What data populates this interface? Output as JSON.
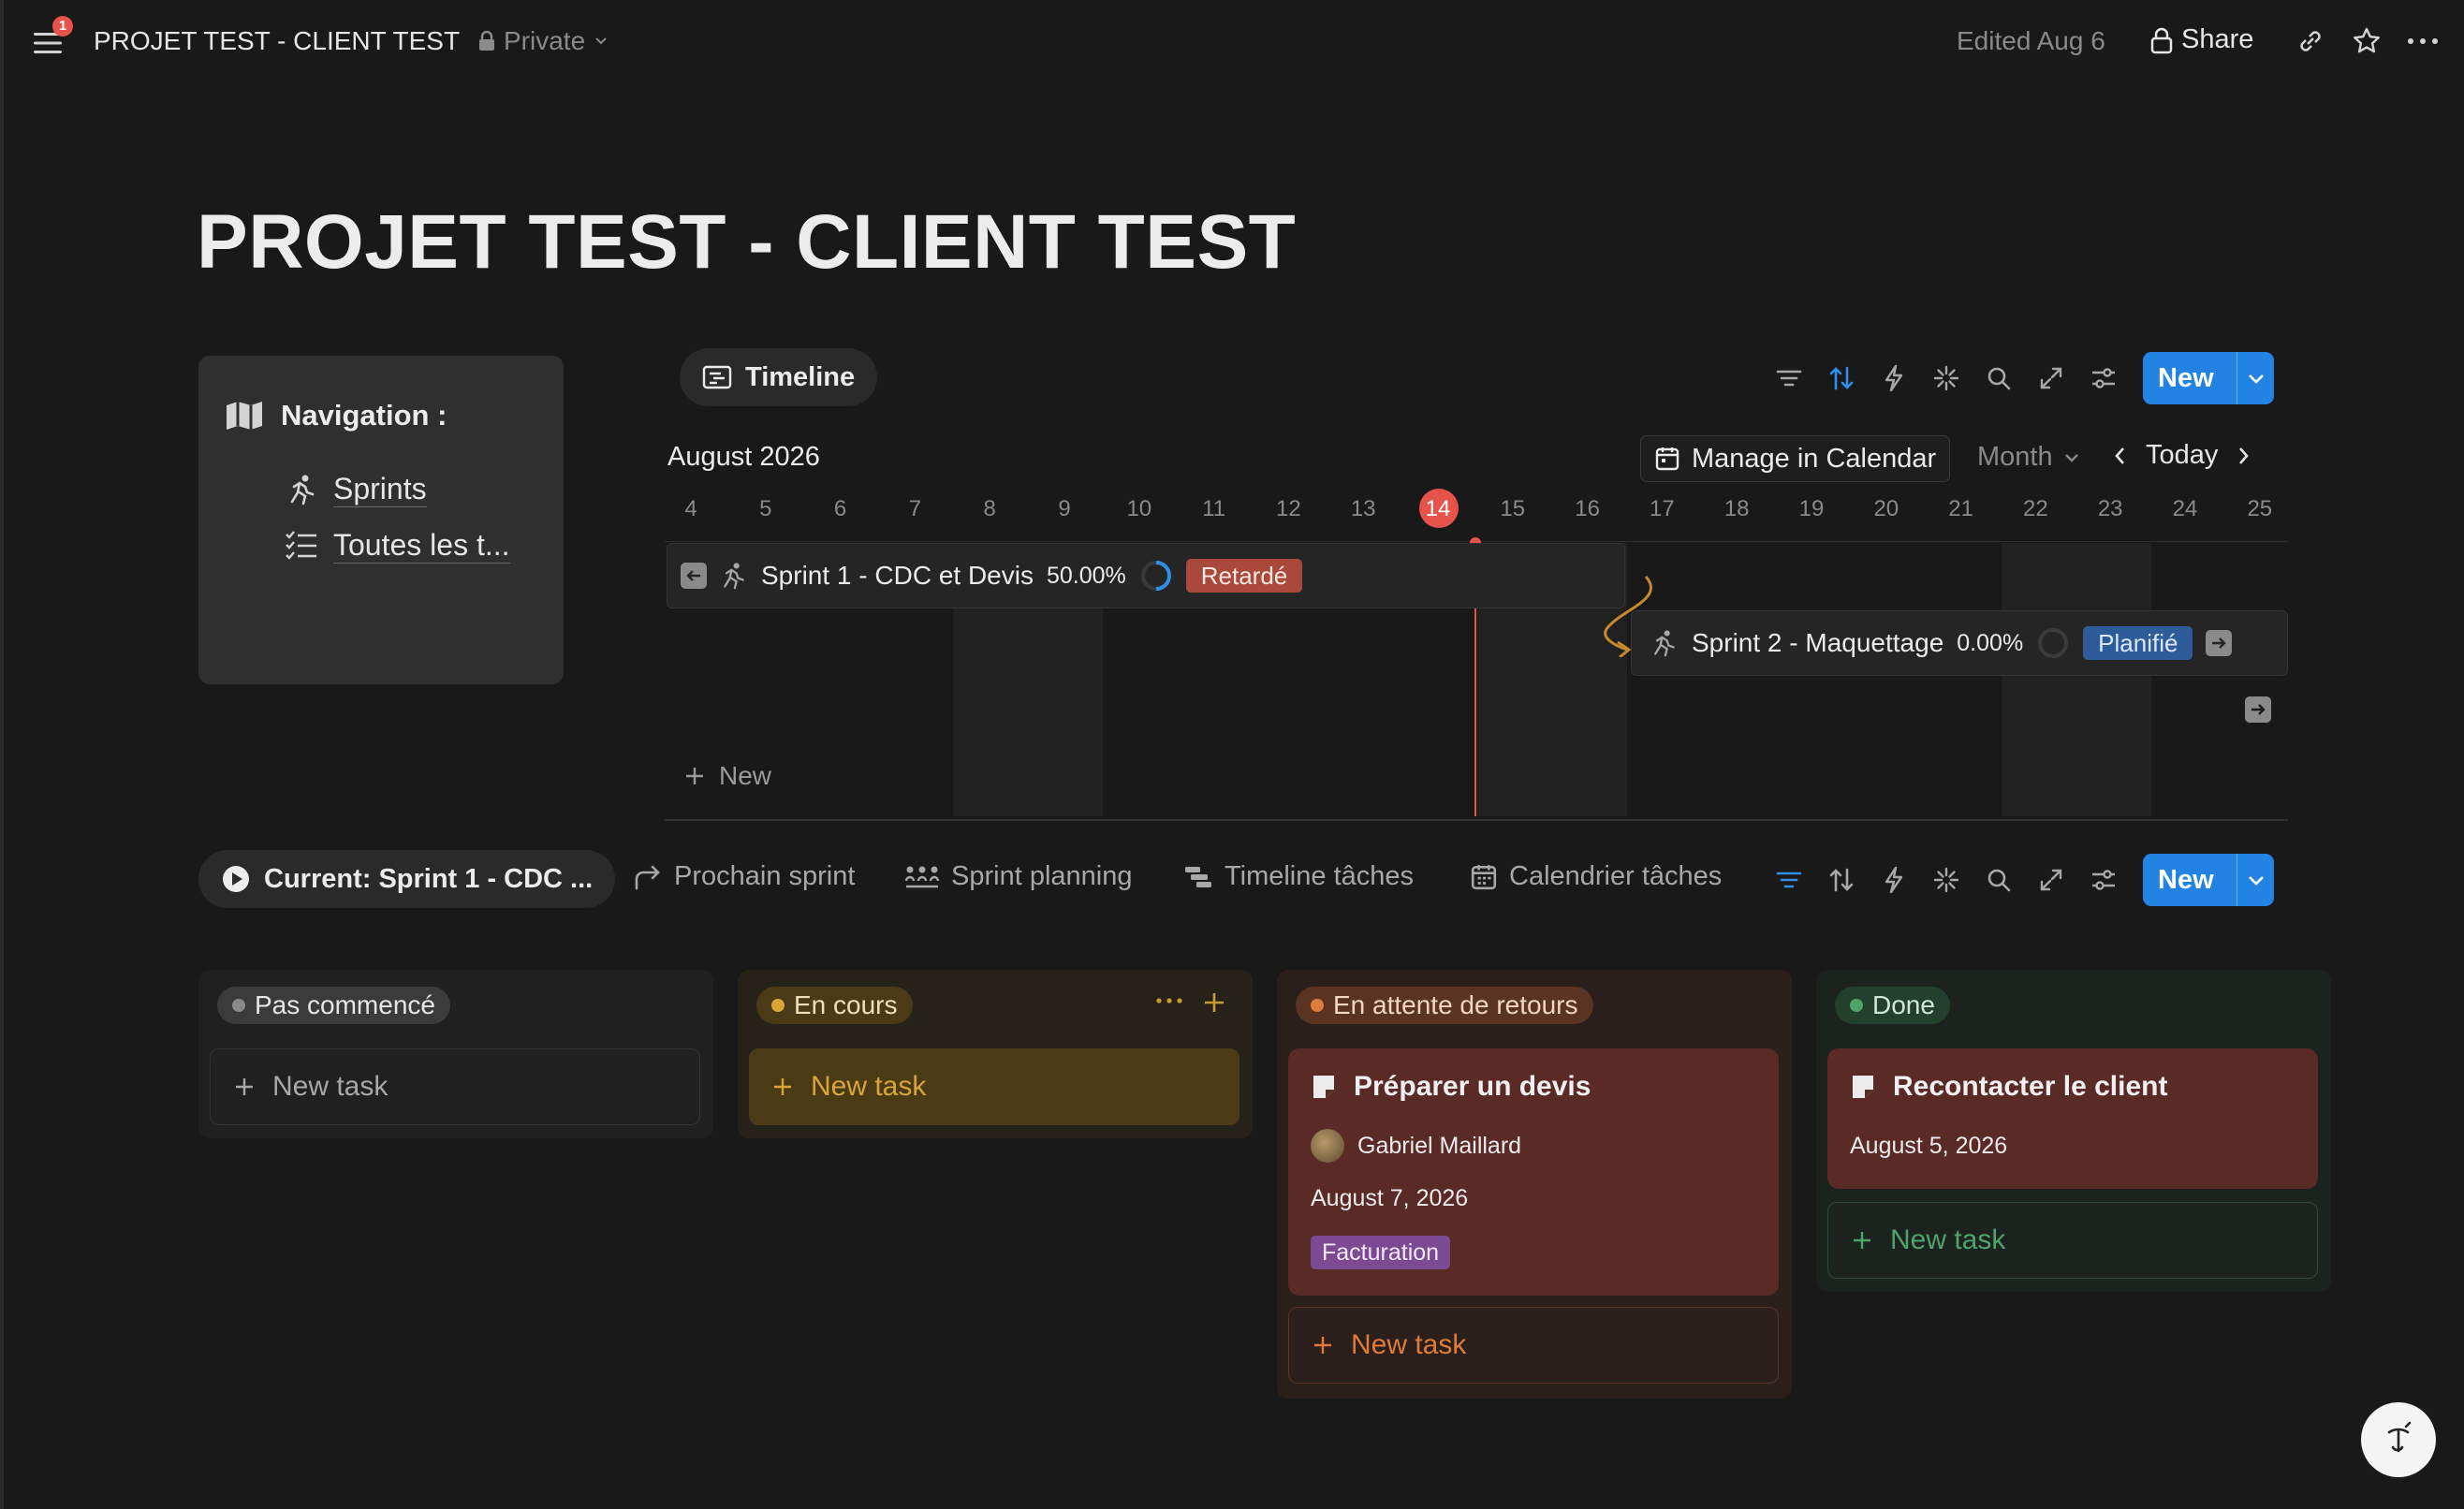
{
  "topbar": {
    "notification_count": "1",
    "breadcrumb": "PROJET TEST - CLIENT TEST",
    "privacy": "Private",
    "edited": "Edited Aug 6",
    "share": "Share"
  },
  "page": {
    "title": "PROJET TEST - CLIENT TEST"
  },
  "navigation": {
    "heading": "Navigation :",
    "links": [
      "Sprints",
      "Toutes les t..."
    ]
  },
  "timeline_view": {
    "view_label": "Timeline",
    "new_label": "New",
    "month_label": "August 2026",
    "manage_calendar": "Manage in Calendar",
    "scale": "Month",
    "today": "Today",
    "days": [
      "4",
      "5",
      "6",
      "7",
      "8",
      "9",
      "10",
      "11",
      "12",
      "13",
      "14",
      "15",
      "16",
      "17",
      "18",
      "19",
      "20",
      "21",
      "22",
      "23",
      "24",
      "25"
    ],
    "current_day": "14",
    "add_new": "New",
    "sprints": [
      {
        "name": "Sprint 1 - CDC et Devis",
        "progress": "50.00%",
        "progress_value": 0.5,
        "status": "Retardé",
        "status_color": "#a8493c"
      },
      {
        "name": "Sprint 2 - Maquettage",
        "progress": "0.00%",
        "progress_value": 0.0,
        "status": "Planifié",
        "status_color": "#2e5b9a"
      }
    ]
  },
  "board_view": {
    "current_tab": "Current: Sprint 1 - CDC ...",
    "tabs": [
      "Prochain sprint",
      "Sprint planning",
      "Timeline tâches",
      "Calendrier tâches"
    ],
    "new_label": "New",
    "new_task": "New task",
    "columns": [
      {
        "name": "Pas commencé",
        "color": "#8a8a8a",
        "cards": []
      },
      {
        "name": "En cours",
        "color": "#d9a536",
        "cards": []
      },
      {
        "name": "En attente de retours",
        "color": "#e07b39",
        "cards": [
          {
            "title": "Préparer un devis",
            "assignee": "Gabriel Maillard",
            "date": "August 7, 2026",
            "tag": "Facturation"
          }
        ]
      },
      {
        "name": "Done",
        "color": "#4fa46a",
        "cards": [
          {
            "title": "Recontacter le client",
            "date": "August 5, 2026"
          }
        ]
      }
    ]
  }
}
